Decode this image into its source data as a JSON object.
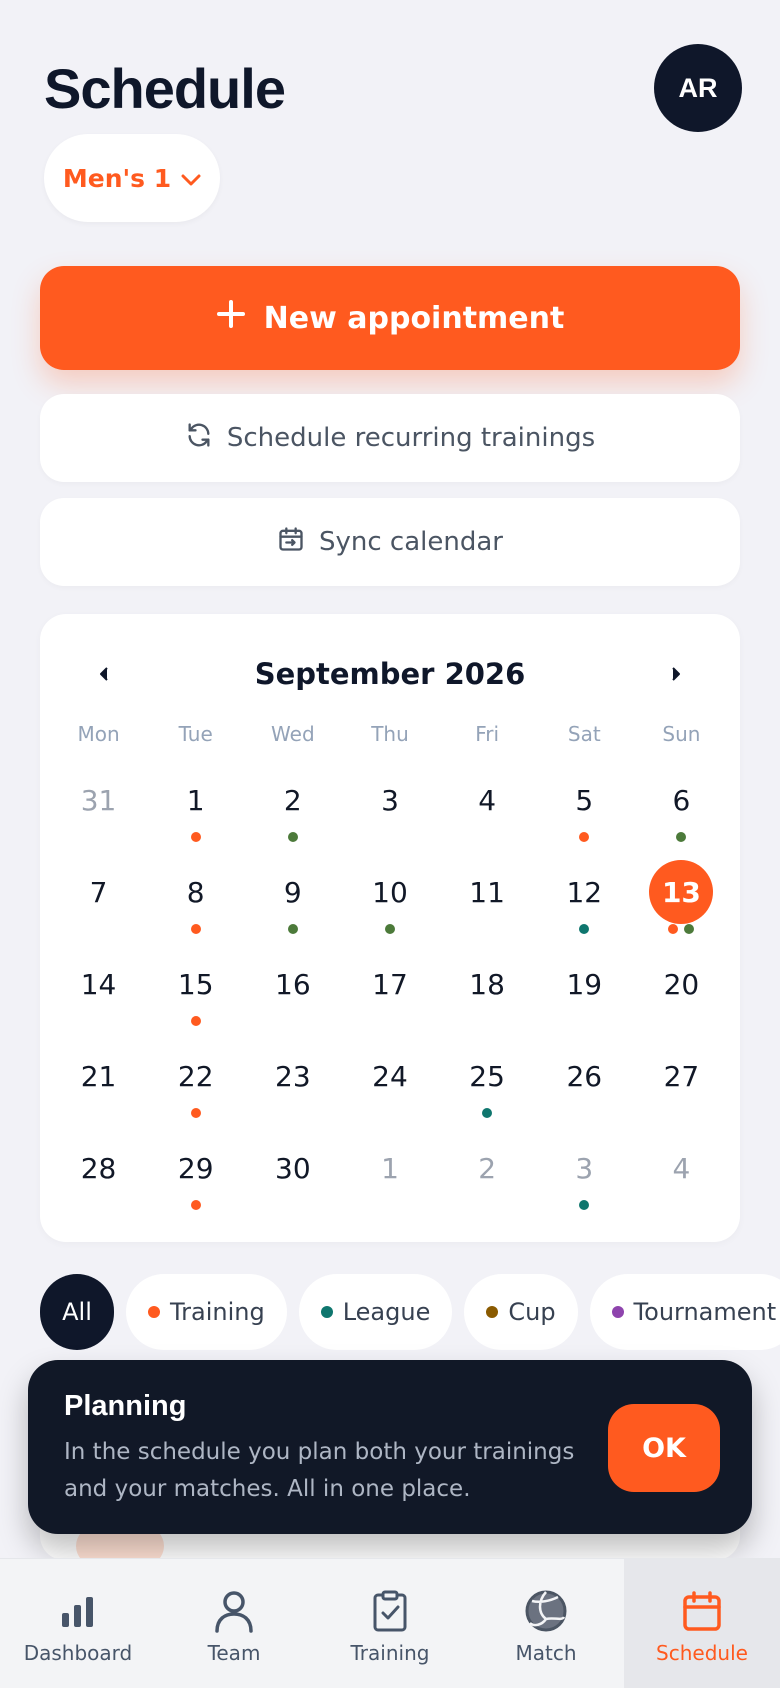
{
  "header": {
    "title": "Schedule",
    "avatar_initials": "AR"
  },
  "team_select": {
    "label": "Men's 1"
  },
  "actions": {
    "new_appointment": "New appointment",
    "recurring": "Schedule recurring trainings",
    "sync": "Sync calendar"
  },
  "colors": {
    "accent": "#ff5a1f",
    "dark": "#0f172a",
    "training": "#ff5a1f",
    "green": "#4c7a3a",
    "league": "#0f766e",
    "cup": "#8a5a00",
    "tournament": "#8e44ad"
  },
  "calendar": {
    "month_label": "September 2026",
    "weekdays": [
      "Mon",
      "Tue",
      "Wed",
      "Thu",
      "Fri",
      "Sat",
      "Sun"
    ],
    "days": [
      {
        "n": "31",
        "muted": true,
        "dots": []
      },
      {
        "n": "1",
        "dots": [
          "training"
        ]
      },
      {
        "n": "2",
        "dots": [
          "green"
        ]
      },
      {
        "n": "3",
        "dots": []
      },
      {
        "n": "4",
        "dots": []
      },
      {
        "n": "5",
        "dots": [
          "training"
        ]
      },
      {
        "n": "6",
        "dots": [
          "green"
        ]
      },
      {
        "n": "7",
        "dots": []
      },
      {
        "n": "8",
        "dots": [
          "training"
        ]
      },
      {
        "n": "9",
        "dots": [
          "green"
        ]
      },
      {
        "n": "10",
        "dots": [
          "green"
        ]
      },
      {
        "n": "11",
        "dots": []
      },
      {
        "n": "12",
        "dots": [
          "league"
        ]
      },
      {
        "n": "13",
        "selected": true,
        "dots": [
          "training",
          "green"
        ]
      },
      {
        "n": "14",
        "dots": []
      },
      {
        "n": "15",
        "dots": [
          "training"
        ]
      },
      {
        "n": "16",
        "dots": []
      },
      {
        "n": "17",
        "dots": []
      },
      {
        "n": "18",
        "dots": []
      },
      {
        "n": "19",
        "dots": []
      },
      {
        "n": "20",
        "dots": []
      },
      {
        "n": "21",
        "dots": []
      },
      {
        "n": "22",
        "dots": [
          "training"
        ]
      },
      {
        "n": "23",
        "dots": []
      },
      {
        "n": "24",
        "dots": []
      },
      {
        "n": "25",
        "dots": [
          "league"
        ]
      },
      {
        "n": "26",
        "dots": []
      },
      {
        "n": "27",
        "dots": []
      },
      {
        "n": "28",
        "dots": []
      },
      {
        "n": "29",
        "dots": [
          "training"
        ]
      },
      {
        "n": "30",
        "dots": []
      },
      {
        "n": "1",
        "muted": true,
        "dots": []
      },
      {
        "n": "2",
        "muted": true,
        "dots": []
      },
      {
        "n": "3",
        "muted": true,
        "dots": [
          "league"
        ]
      },
      {
        "n": "4",
        "muted": true,
        "dots": []
      }
    ]
  },
  "filters": [
    {
      "label": "All",
      "active": true
    },
    {
      "label": "Training",
      "color": "training"
    },
    {
      "label": "League",
      "color": "league"
    },
    {
      "label": "Cup",
      "color": "cup"
    },
    {
      "label": "Tournament",
      "color": "tournament"
    }
  ],
  "toast": {
    "title": "Planning",
    "body": "In the schedule you plan both your trainings and your matches. All in one place.",
    "ok_label": "OK"
  },
  "tabs": [
    {
      "label": "Dashboard",
      "icon": "bar-chart-icon"
    },
    {
      "label": "Team",
      "icon": "person-icon"
    },
    {
      "label": "Training",
      "icon": "clipboard-check-icon"
    },
    {
      "label": "Match",
      "icon": "volleyball-icon"
    },
    {
      "label": "Schedule",
      "icon": "calendar-icon",
      "active": true
    }
  ]
}
